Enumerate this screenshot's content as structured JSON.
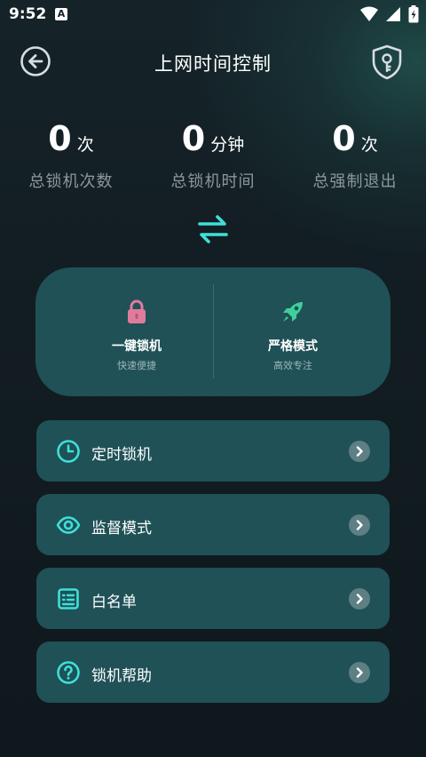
{
  "status_bar": {
    "time": "9:52",
    "notification_glyph": "A",
    "icons": [
      "wifi-icon",
      "signal-icon",
      "battery-charging-icon"
    ]
  },
  "header": {
    "title": "上网时间控制",
    "back_icon": "back-arrow-icon",
    "right_icon": "shield-key-icon"
  },
  "stats": [
    {
      "value": "0",
      "unit": "次",
      "label": "总锁机次数"
    },
    {
      "value": "0",
      "unit": "分钟",
      "label": "总锁机时间"
    },
    {
      "value": "0",
      "unit": "次",
      "label": "总强制退出"
    }
  ],
  "switch_icon": "swap-arrows-icon",
  "modes": [
    {
      "title": "一键锁机",
      "subtitle": "快速便捷",
      "icon": "lock-icon"
    },
    {
      "title": "严格模式",
      "subtitle": "高效专注",
      "icon": "rocket-icon"
    }
  ],
  "menu": [
    {
      "label": "定时锁机",
      "icon": "clock-icon"
    },
    {
      "label": "监督模式",
      "icon": "eye-icon"
    },
    {
      "label": "白名单",
      "icon": "list-icon"
    },
    {
      "label": "锁机帮助",
      "icon": "help-icon"
    }
  ],
  "colors": {
    "accent": "#3fe0d8",
    "card": "#1f5157",
    "background": "#121d22",
    "muted_text": "#8d979b",
    "lock_pink": "#e07b9e"
  }
}
